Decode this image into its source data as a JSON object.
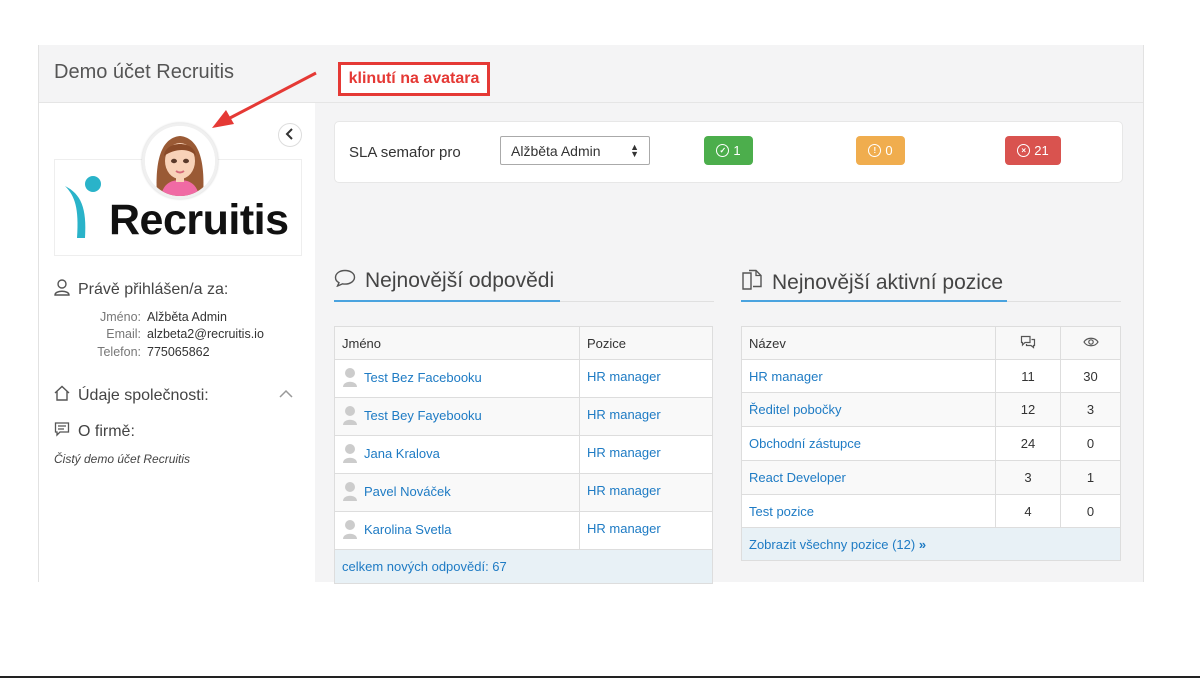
{
  "app": {
    "title": "Demo účet Recruitis"
  },
  "annotation": {
    "label": "klinutí na avatara"
  },
  "sidebar": {
    "logo_text": "Recruitis",
    "logged_in_heading": "Právě přihlášen/a za:",
    "fields": [
      {
        "label": "Jméno:",
        "value": "Alžběta Admin"
      },
      {
        "label": "Email:",
        "value": "alzbeta2@recruitis.io"
      },
      {
        "label": "Telefon:",
        "value": "775065862"
      }
    ],
    "company_heading": "Údaje společnosti:",
    "about_heading": "O firmě:",
    "about_text": "Čistý demo účet Recruitis"
  },
  "sla": {
    "label": "SLA semafor pro",
    "selected_user": "Alžběta Admin",
    "badges": [
      {
        "icon": "check-circle-icon",
        "count": "1",
        "color": "#4cae4c"
      },
      {
        "icon": "exclamation-circle-icon",
        "count": "0",
        "color": "#f0ad4e"
      },
      {
        "icon": "x-circle-icon",
        "count": "21",
        "color": "#d9534f"
      }
    ]
  },
  "responses": {
    "title": "Nejnovější odpovědi",
    "columns": [
      "Jméno",
      "Pozice"
    ],
    "rows": [
      {
        "name": "Test Bez Facebooku",
        "position": "HR manager"
      },
      {
        "name": "Test Bey Fayebooku",
        "position": "HR manager"
      },
      {
        "name": "Jana Kralova",
        "position": "HR manager"
      },
      {
        "name": "Pavel Nováček",
        "position": "HR manager"
      },
      {
        "name": "Karolina Svetla",
        "position": "HR manager"
      }
    ],
    "footer": "celkem nových odpovědí: 67"
  },
  "positions": {
    "title": "Nejnovější aktivní pozice",
    "columns": [
      "Název"
    ],
    "column_icons": [
      "comments-icon",
      "eye-icon"
    ],
    "rows": [
      {
        "name": "HR manager",
        "responses": "11",
        "views": "30"
      },
      {
        "name": "Ředitel pobočky",
        "responses": "12",
        "views": "3"
      },
      {
        "name": "Obchodní zástupce",
        "responses": "24",
        "views": "0"
      },
      {
        "name": "React Developer",
        "responses": "3",
        "views": "1"
      },
      {
        "name": "Test pozice",
        "responses": "4",
        "views": "0"
      }
    ],
    "footer": "Zobrazit všechny pozice (12)"
  },
  "colors": {
    "accent": "#1e7bc4",
    "underline": "#4aa3df",
    "annotation": "#e53935"
  }
}
